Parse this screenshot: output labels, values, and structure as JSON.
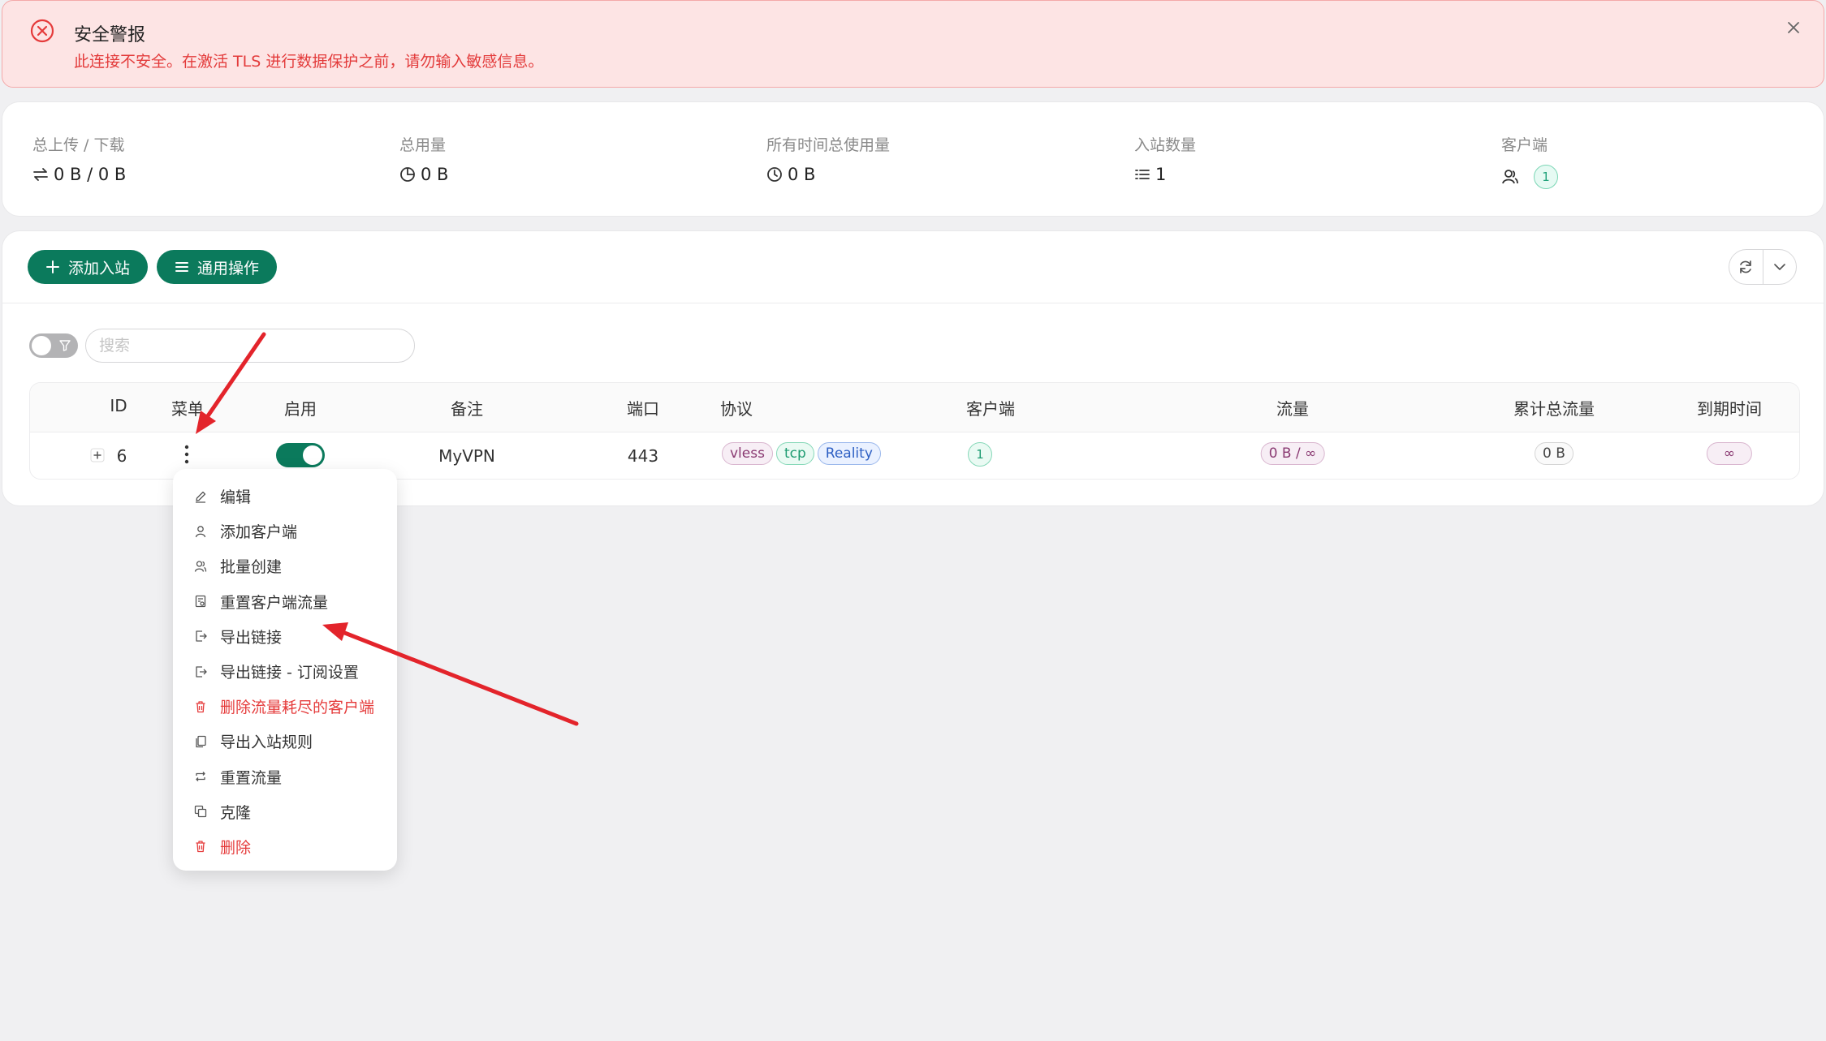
{
  "alert": {
    "title": "安全警报",
    "message": "此连接不安全。在激活 TLS 进行数据保护之前，请勿输入敏感信息。"
  },
  "stats": {
    "upload_download": {
      "label": "总上传 / 下载",
      "value": "0 B / 0 B",
      "icon": "swap-arrows-icon"
    },
    "total_usage": {
      "label": "总用量",
      "value": "0 B",
      "icon": "pie-chart-icon"
    },
    "all_time_usage": {
      "label": "所有时间总使用量",
      "value": "0 B",
      "icon": "clock-icon"
    },
    "inbound_count": {
      "label": "入站数量",
      "value": "1",
      "icon": "list-icon"
    },
    "clients": {
      "label": "客户端",
      "value": "1",
      "icon": "users-icon"
    }
  },
  "toolbar": {
    "add_inbound": "添加入站",
    "general_actions": "通用操作",
    "search_placeholder": "搜索"
  },
  "table": {
    "headers": {
      "id": "ID",
      "menu": "菜单",
      "enable": "启用",
      "remark": "备注",
      "port": "端口",
      "protocol": "协议",
      "clients": "客户端",
      "traffic": "流量",
      "total_traffic": "累计总流量",
      "expiry": "到期时间"
    },
    "rows": [
      {
        "id": "6",
        "enabled": true,
        "remark": "MyVPN",
        "port": "443",
        "protocol_tags": [
          "vless",
          "tcp",
          "Reality"
        ],
        "clients": "1",
        "traffic": "0 B / ∞",
        "total_traffic": "0 B",
        "expiry": "∞"
      }
    ]
  },
  "menu": {
    "items": [
      {
        "label": "编辑",
        "icon": "edit-icon",
        "danger": false
      },
      {
        "label": "添加客户端",
        "icon": "user-icon",
        "danger": false
      },
      {
        "label": "批量创建",
        "icon": "users-icon",
        "danger": false
      },
      {
        "label": "重置客户端流量",
        "icon": "reset-file-icon",
        "danger": false
      },
      {
        "label": "导出链接",
        "icon": "export-icon",
        "danger": false
      },
      {
        "label": "导出链接 - 订阅设置",
        "icon": "export-icon",
        "danger": false
      },
      {
        "label": "删除流量耗尽的客户端",
        "icon": "delete-icon",
        "danger": true
      },
      {
        "label": "导出入站规则",
        "icon": "copy-file-icon",
        "danger": false
      },
      {
        "label": "重置流量",
        "icon": "retweet-icon",
        "danger": false
      },
      {
        "label": "克隆",
        "icon": "clone-icon",
        "danger": false
      },
      {
        "label": "删除",
        "icon": "delete-icon",
        "danger": true
      }
    ]
  },
  "colors": {
    "primary": "#0b7a5c",
    "danger": "#e53b3b",
    "alert_bg": "#fde4e4",
    "annotation_arrow": "#e3242b"
  }
}
